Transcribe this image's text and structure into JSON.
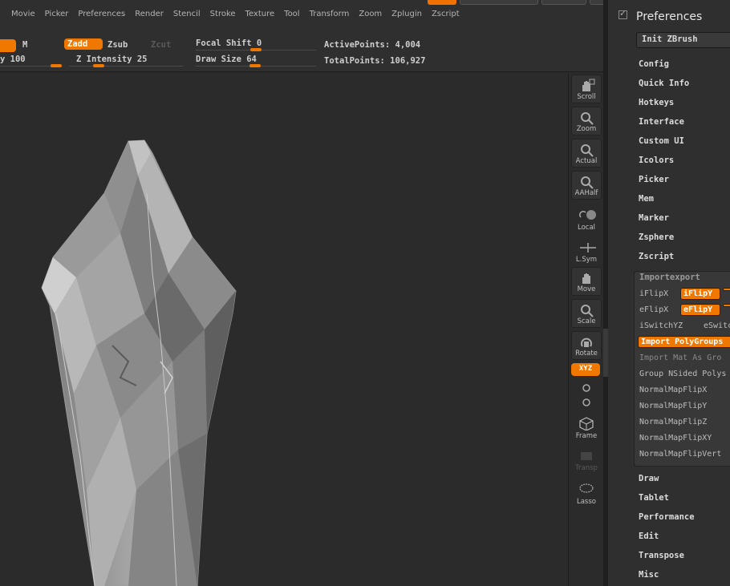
{
  "menubar": {
    "items": [
      "Movie",
      "Picker",
      "Preferences",
      "Render",
      "Stencil",
      "Stroke",
      "Texture",
      "Tool",
      "Transform",
      "Zoom",
      "Zplugin",
      "Zscript"
    ]
  },
  "toolbar": {
    "m_label": "M",
    "zadd_label": "Zadd",
    "zsub_label": "Zsub",
    "zcut_label": "Zcut",
    "intensity_label": "y 100",
    "z_intensity_label": "Z Intensity 25",
    "focal_shift_label": "Focal Shift 0",
    "draw_size_label": "Draw Size 64",
    "active_points_label": "ActivePoints: 4,004",
    "total_points_label": "TotalPoints: 106,927"
  },
  "shelf": {
    "scroll": "Scroll",
    "zoom": "Zoom",
    "actual": "Actual",
    "aahalf": "AAHalf",
    "local": "Local",
    "lsym": "L.Sym",
    "move": "Move",
    "scale": "Scale",
    "rotate": "Rotate",
    "xyz": "XYZ",
    "frame": "Frame",
    "transp": "Transp",
    "lasso": "Lasso"
  },
  "preferences": {
    "title": "Preferences",
    "init_button": "Init ZBrush",
    "items_top": [
      "Config",
      "Quick Info",
      "Hotkeys",
      "Interface",
      "Custom UI",
      "Icolors",
      "Picker",
      "Mem",
      "Marker",
      "Zsphere",
      "Zscript"
    ],
    "importexport": {
      "title": "Importexport",
      "iflipx": "iFlipX",
      "iflipy": "iFlipY",
      "eflipx": "eFlipX",
      "eflipy": "eFlipY",
      "iswitchyz": "iSwitchYZ",
      "eswitch": "eSwitc",
      "import_polygroups": "Import PolyGroups",
      "import_mat": "Import Mat As Gro",
      "group_nsided": "Group NSided Polys",
      "nm_flipx": "NormalMapFlipX",
      "nm_flipy": "NormalMapFlipY",
      "nm_flipz": "NormalMapFlipZ",
      "nm_flipxy": "NormalMapFlipXY",
      "nm_flipvert": "NormalMapFlipVert"
    },
    "items_bottom": [
      "Draw",
      "Tablet",
      "Performance",
      "Edit",
      "Transpose",
      "Misc"
    ]
  }
}
